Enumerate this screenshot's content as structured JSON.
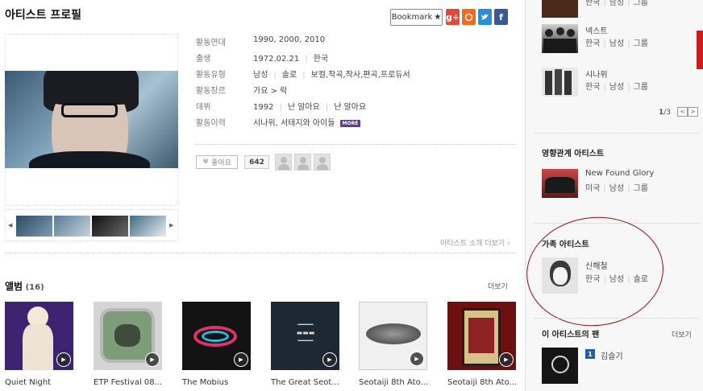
{
  "header": {
    "title": "아티스트 프로필",
    "bookmark_label": "Bookmark",
    "share": [
      {
        "label": "g+",
        "color": "#dd4b39",
        "name": "googleplus"
      },
      {
        "label": "♂",
        "color": "#f26b1d",
        "name": "kakao"
      },
      {
        "label": "t",
        "color": "#2a8fd4",
        "name": "twitter"
      },
      {
        "label": "f",
        "color": "#3b5998",
        "name": "facebook"
      }
    ]
  },
  "profile": {
    "labels": {
      "active_years": "활동연대",
      "birth": "출생",
      "type": "활동유형",
      "genre": "활동장르",
      "debut": "데뷔",
      "history": "활동이력"
    },
    "active_years": "1990, 2000, 2010",
    "birth": "1972.02.21",
    "birth_country": "한국",
    "type_gender": "남성",
    "type_form": "솔로",
    "type_roles": "보컬,작곡,작사,편곡,프로듀서",
    "genre": "가요 > 락",
    "debut_year": "1992",
    "debut_song1": "난 알아요",
    "debut_song2": "난 알아요",
    "history": "시나위, 서태지와 아이들",
    "more_badge": "MORE",
    "like_label": "좋아요",
    "like_count": "642",
    "intro_more": "아티스트 소개 더보기 ›"
  },
  "albums": {
    "title": "앨범",
    "count": "16",
    "more": "더보기",
    "items": [
      {
        "title": "Quiet Night",
        "cover": "#3d2470"
      },
      {
        "title": "ETP Festival 08...",
        "cover": "#cfcfcf"
      },
      {
        "title": "The Mobius",
        "cover": "#151515"
      },
      {
        "title": "The Great Seot...",
        "cover": "#1e2a36"
      },
      {
        "title": "Seotaiji 8th Ato...",
        "cover": "#eeeeee"
      },
      {
        "title": "Seotaiji 8th Ato...",
        "cover": "#6e1010"
      }
    ]
  },
  "right": {
    "top_partial": {
      "country": "한국",
      "gender": "남성",
      "form": "그룹"
    },
    "similar": [
      {
        "name": "넥스트",
        "country": "한국",
        "gender": "남성",
        "form": "그룹"
      },
      {
        "name": "시나위",
        "country": "한국",
        "gender": "남성",
        "form": "그룹"
      }
    ],
    "pager": {
      "current": "1",
      "total": "/3"
    },
    "influence_title": "영향관계 아티스트",
    "influence": {
      "name": "New Found Glory",
      "country": "미국",
      "gender": "남성",
      "form": "그룹"
    },
    "family_title": "가족 아티스트",
    "family": {
      "name": "신해철",
      "country": "한국",
      "gender": "남성",
      "form": "솔로"
    },
    "fans_title": "이 아티스트의 팬",
    "fans_more": "더보기",
    "fans": [
      {
        "rank": "1",
        "name": "김슬기"
      }
    ]
  }
}
